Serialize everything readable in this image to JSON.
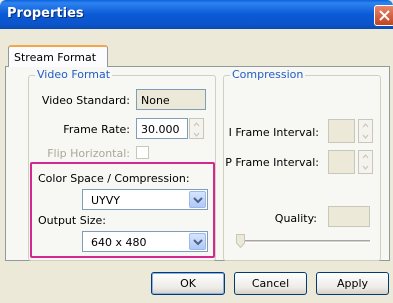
{
  "window": {
    "title": "Properties"
  },
  "tabs": [
    {
      "label": "Stream Format",
      "selected": true
    }
  ],
  "video_format": {
    "legend": "Video Format",
    "video_standard": {
      "label": "Video Standard:",
      "value": "None"
    },
    "frame_rate": {
      "label": "Frame Rate:",
      "value": "30.000"
    },
    "flip_horizontal": {
      "label": "Flip Horizontal:",
      "checked": false,
      "enabled": false
    },
    "color_space": {
      "label": "Color Space / Compression:",
      "value": "UYVY"
    },
    "output_size": {
      "label": "Output Size:",
      "value": "640 x 480"
    }
  },
  "compression": {
    "legend": "Compression",
    "i_frame_interval": {
      "label": "I Frame Interval:",
      "value": ""
    },
    "p_frame_interval": {
      "label": "P Frame Interval:",
      "value": ""
    },
    "quality": {
      "label": "Quality:",
      "value": ""
    }
  },
  "buttons": {
    "ok": "OK",
    "cancel": "Cancel",
    "apply": "Apply"
  },
  "colors": {
    "title_bar": "#0a5ad6",
    "highlight_box": "#d4288e",
    "group_legend": "#215dc6",
    "tab_accent": "#f5a64a"
  }
}
